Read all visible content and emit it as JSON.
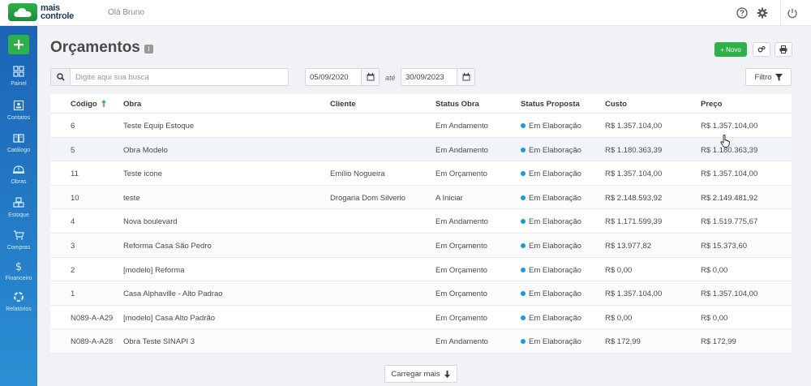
{
  "app": {
    "logo_line1": "mais",
    "logo_line2": "controle",
    "greeting": "Olá Bruno",
    "help_icon": "help-circle-icon",
    "settings_icon": "gear-icon",
    "power_icon": "power-icon"
  },
  "sidebar": {
    "add_icon": "plus-icon",
    "items": [
      {
        "label": "Painel",
        "icon": "grid-icon"
      },
      {
        "label": "Contatos",
        "icon": "contact-card-icon"
      },
      {
        "label": "Catálogo",
        "icon": "book-icon"
      },
      {
        "label": "Obras",
        "icon": "helmet-icon"
      },
      {
        "label": "Estoque",
        "icon": "boxes-icon"
      },
      {
        "label": "Compras",
        "icon": "cart-icon"
      },
      {
        "label": "Financeiro",
        "icon": "dollar-icon"
      },
      {
        "label": "Relatórios",
        "icon": "chart-icon"
      }
    ]
  },
  "page": {
    "title": "Orçamentos",
    "info_badge": "i",
    "new_button": "+ Novo",
    "search_placeholder": "Digite aqui sua busca",
    "date_from": "05/09/2020",
    "date_sep": "até",
    "date_to": "30/09/2023",
    "filter_button": "Filtro",
    "load_more": "Carregar mais"
  },
  "colors": {
    "brand_green": "#2db24a",
    "sidebar_blue": "#1f6fbf",
    "status_dot": "#1a9ad6"
  },
  "table": {
    "headers": {
      "codigo": "Código",
      "obra": "Obra",
      "cliente": "Cliente",
      "status_obra": "Status Obra",
      "status_proposta": "Status Proposta",
      "custo": "Custo",
      "preco": "Preço"
    },
    "rows": [
      {
        "codigo": "6",
        "obra": "Teste Equip Estoque",
        "cliente": "",
        "status_obra": "Em Andamento",
        "status_proposta": "Em Elaboração",
        "custo": "R$ 1.357.104,00",
        "preco": "R$ 1.357.104,00"
      },
      {
        "codigo": "5",
        "obra": "Obra Modelo",
        "cliente": "",
        "status_obra": "Em Andamento",
        "status_proposta": "Em Elaboração",
        "custo": "R$ 1.180.363,39",
        "preco": "R$ 1.180.363,39"
      },
      {
        "codigo": "11",
        "obra": "Teste icone",
        "cliente": "Emílio Nogueira",
        "status_obra": "Em Orçamento",
        "status_proposta": "Em Elaboração",
        "custo": "R$ 1.357.104,00",
        "preco": "R$ 1.357.104,00"
      },
      {
        "codigo": "10",
        "obra": "teste",
        "cliente": "Drogaria Dom Silverio",
        "status_obra": "A Iniciar",
        "status_proposta": "Em Elaboração",
        "custo": "R$ 2.148.593,92",
        "preco": "R$ 2.149.481,92"
      },
      {
        "codigo": "4",
        "obra": "Nova boulevard",
        "cliente": "",
        "status_obra": "Em Andamento",
        "status_proposta": "Em Elaboração",
        "custo": "R$ 1.171.599,39",
        "preco": "R$ 1.519.775,67"
      },
      {
        "codigo": "3",
        "obra": "Reforma Casa São Pedro",
        "cliente": "",
        "status_obra": "Em Orçamento",
        "status_proposta": "Em Elaboração",
        "custo": "R$ 13.977,82",
        "preco": "R$ 15.373,60"
      },
      {
        "codigo": "2",
        "obra": "[modelo] Reforma",
        "cliente": "",
        "status_obra": "Em Orçamento",
        "status_proposta": "Em Elaboração",
        "custo": "R$ 0,00",
        "preco": "R$ 0,00"
      },
      {
        "codigo": "1",
        "obra": "Casa Alphaville - Alto Padrao",
        "cliente": "",
        "status_obra": "Em Orçamento",
        "status_proposta": "Em Elaboração",
        "custo": "R$ 1.357.104,00",
        "preco": "R$ 1.357.104,00"
      },
      {
        "codigo": "N089-A-A29",
        "obra": "[modelo] Casa Alto Padrão",
        "cliente": "",
        "status_obra": "Em Orçamento",
        "status_proposta": "Em Elaboração",
        "custo": "R$ 0,00",
        "preco": "R$ 0,00"
      },
      {
        "codigo": "N089-A-A28",
        "obra": "Obra Teste SINAPI 3",
        "cliente": "",
        "status_obra": "Em Andamento",
        "status_proposta": "Em Elaboração",
        "custo": "R$ 172,99",
        "preco": "R$ 172,99"
      }
    ]
  }
}
